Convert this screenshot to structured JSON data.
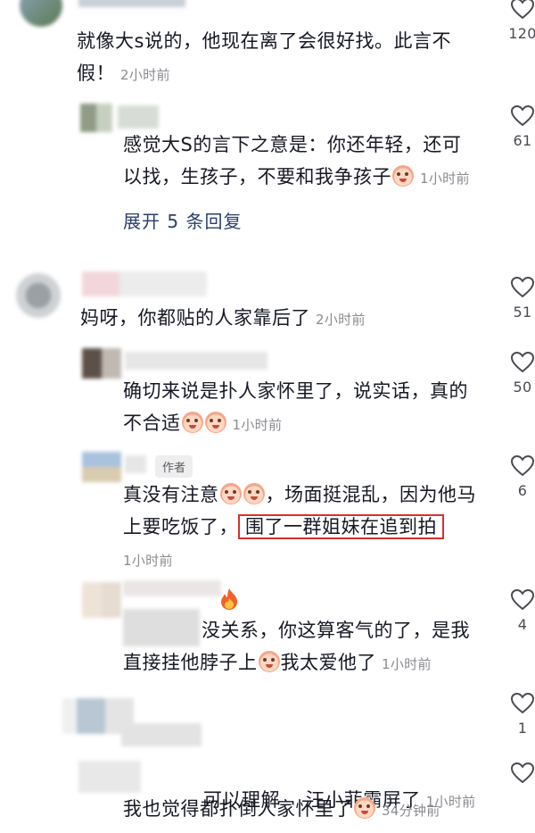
{
  "comments": [
    {
      "text": "就像大s说的，他现在离了会很好找。此言不假！",
      "line1": "就像大s说的，他现在离了会很好找。此言不",
      "line2": "假！",
      "time": "2小时前",
      "likes": "120"
    },
    {
      "line1": "感觉大S的言下之意是：你还年轻，还可",
      "line2": "以找，生孩子，不要和我争孩子",
      "time": "1小时前",
      "likes": "61"
    },
    {
      "line1": "妈呀，你都贴的人家靠后了",
      "time": "2小时前",
      "likes": "51"
    },
    {
      "line1": "确切来说是扑人家怀里了，说实话，真的",
      "line2": "不合适",
      "time": "1小时前",
      "likes": "50"
    },
    {
      "author_tag": "作者",
      "line1": "真没有注意",
      "line1b": "，场面挺混乱，因为他马",
      "line2": "上要吃饭了，",
      "line2_highlight": "围了一群姐妹在追到拍",
      "time": "1小时前",
      "likes": "6"
    },
    {
      "line1": "没关系，你这算客气的了，是我",
      "line2a": "直接挂他脖子上",
      "line2b": "我太爱他了",
      "time": "1小时前",
      "likes": "4"
    },
    {
      "line1": "可以理解    汪小菲霸屏了",
      "time": "1小时前",
      "likes": "1"
    },
    {
      "line1": "我也觉得都扑倒人家怀里了",
      "time": "34分钟前"
    }
  ],
  "expand_replies": "展开 5 条回复",
  "icons": {
    "like": "heart-outline-icon",
    "fire": "fire-icon",
    "emoji": "crying-face-emoji-icon"
  },
  "colors": {
    "highlight_border": "#d6312d",
    "time_text": "#8a8b91",
    "expand_link": "#2c3e6b"
  }
}
